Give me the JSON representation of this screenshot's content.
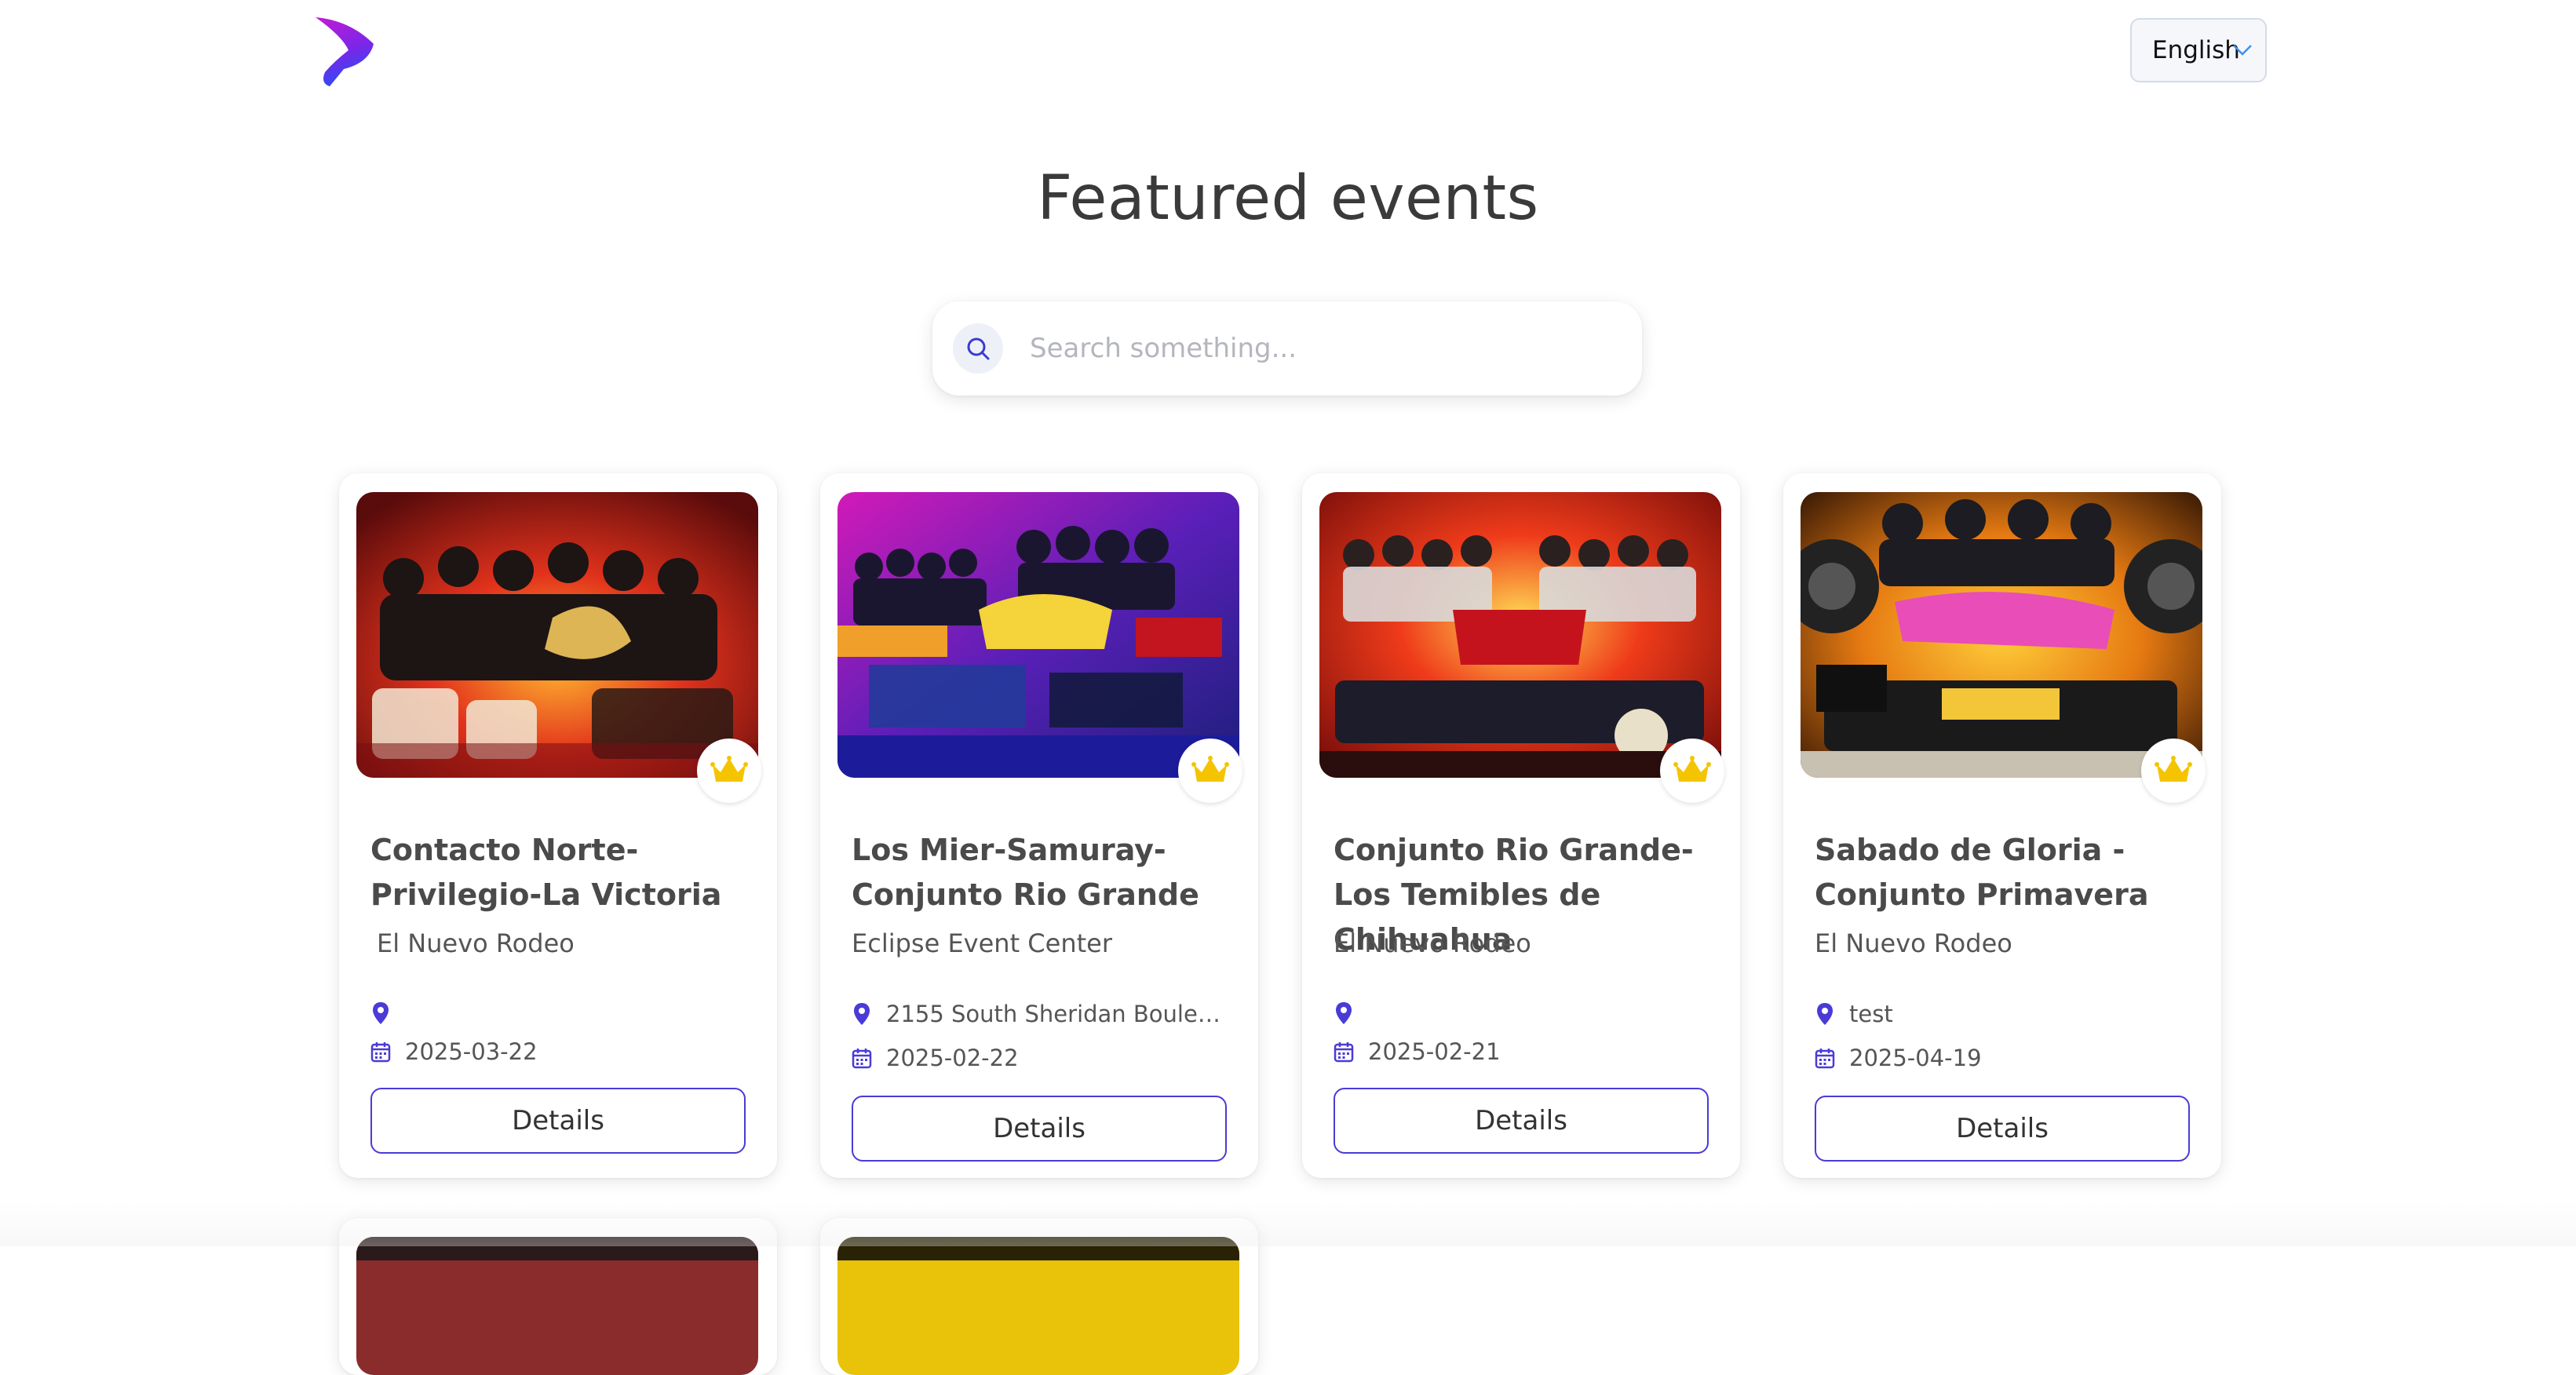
{
  "header": {
    "language": "English"
  },
  "page": {
    "title": "Featured events"
  },
  "search": {
    "placeholder": "Search something..."
  },
  "colors": {
    "accent": "#4b3bd6",
    "crown": "#f5c400",
    "logo_top": "#b01ad9",
    "logo_bottom": "#3b3bf0"
  },
  "events": [
    {
      "title": "Contacto Norte-Privilegio-La Victoria",
      "venue": "El Nuevo Rodeo",
      "address": "",
      "date": "2025-03-22",
      "button": "Details"
    },
    {
      "title": "Los Mier-Samuray-Conjunto Rio Grande",
      "venue": "Eclipse Event Center",
      "address": "2155 South Sheridan Boulevar...",
      "date": "2025-02-22",
      "button": "Details"
    },
    {
      "title": "Conjunto Rio Grande-Los Temibles de Chihuahua",
      "venue": "El Nuevo Rodeo",
      "address": "",
      "date": "2025-02-21",
      "button": "Details"
    },
    {
      "title": "Sabado de Gloria - Conjunto Primavera",
      "venue": "El Nuevo Rodeo",
      "address": "test",
      "date": "2025-04-19",
      "button": "Details"
    }
  ]
}
